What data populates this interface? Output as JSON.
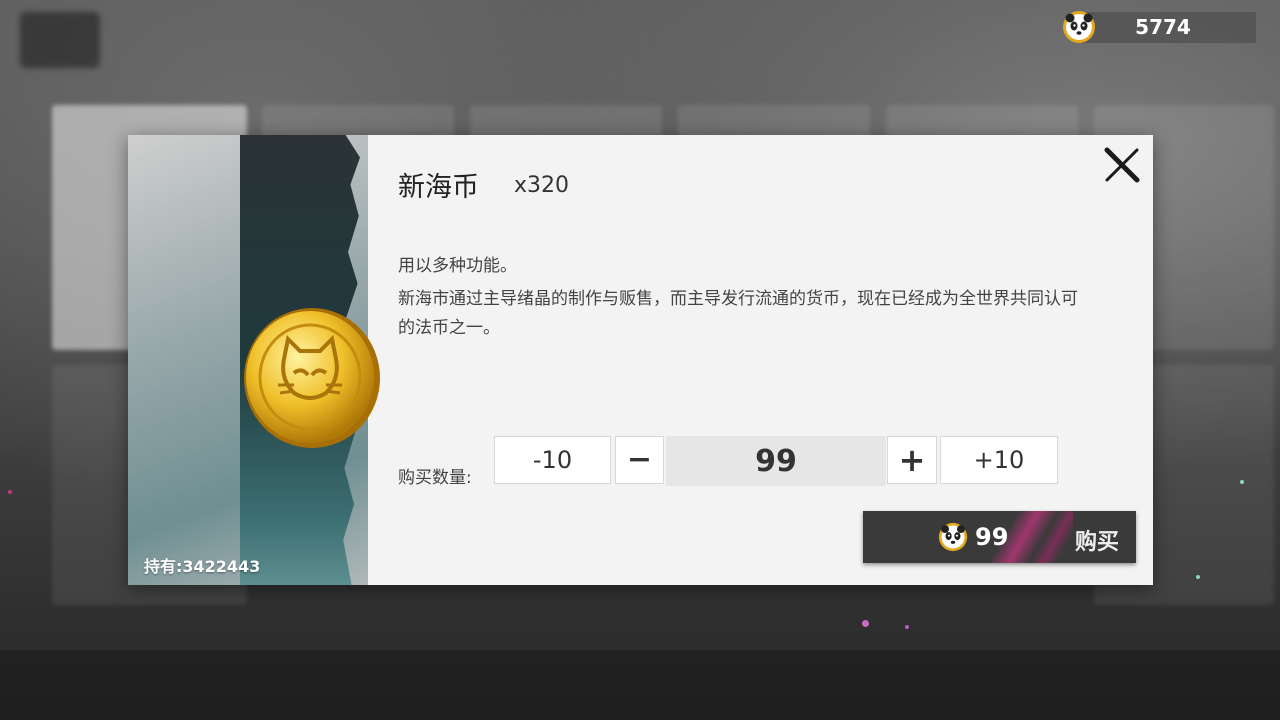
{
  "header": {
    "currency_icon": "panda-coin-icon",
    "currency_amount": "5774"
  },
  "dialog": {
    "item_name": "新海币",
    "item_count": "x320",
    "owned": "持有:3422443",
    "description_short": "用以多种功能。",
    "description_long": "新海市通过主导绪晶的制作与贩售，而主导发行流通的货币，现在已经成为全世界共同认可的法币之一。",
    "quantity": {
      "label": "购买数量:",
      "minus10_label": "-10",
      "minus_label": "−",
      "value": "99",
      "plus_label": "+",
      "plus10_label": "+10"
    },
    "buy": {
      "price_icon": "panda-coin-icon",
      "price": "99",
      "label": "购买"
    }
  },
  "colors": {
    "dialog_bg": "#f3f3f3",
    "buy_button_bg": "#3a3a3a",
    "accent_pink": "#c2357f",
    "coin_gold": "#e8b320"
  }
}
